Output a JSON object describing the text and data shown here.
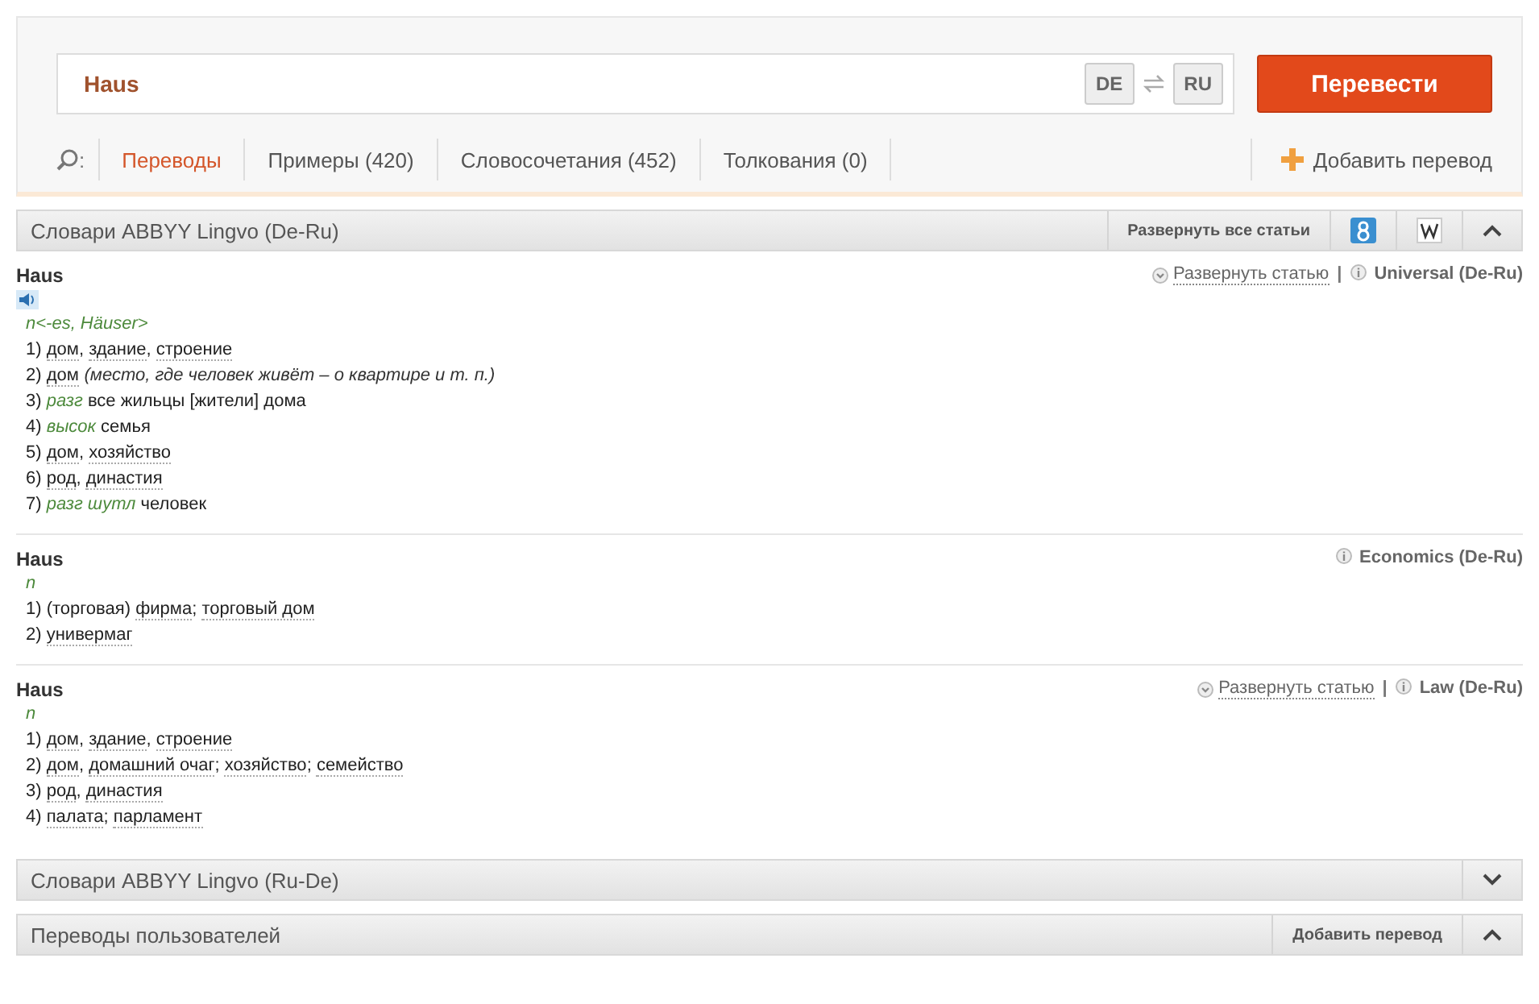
{
  "search": {
    "value": "Haus",
    "source_lang": "DE",
    "target_lang": "RU",
    "button": "Перевести"
  },
  "tabs_label": ":",
  "tabs": [
    {
      "label": "Переводы",
      "selected": true
    },
    {
      "label": "Примеры (420)",
      "selected": false
    },
    {
      "label": "Словосочетания (452)",
      "selected": false
    },
    {
      "label": "Толкования (0)",
      "selected": false
    }
  ],
  "add_translation": "Добавить перевод",
  "sections": [
    {
      "title": "Словари ABBYY Lingvo (De-Ru)",
      "expanded": true,
      "expand_all": "Развернуть все статьи",
      "tools": [
        {
          "kind": "google"
        },
        {
          "kind": "wiki"
        }
      ],
      "entries": [
        {
          "headword": "Haus",
          "sound": true,
          "expand": "Развернуть статью",
          "separator": "|",
          "dictionary": "Universal (De-Ru)",
          "grammar": "n<-es, Häuser>",
          "meanings": [
            {
              "num": "1)",
              "parts": [
                {
                  "kind": "word",
                  "text": "дом"
                },
                {
                  "kind": "text",
                  "text": ", "
                },
                {
                  "kind": "word",
                  "text": "здание"
                },
                {
                  "kind": "text",
                  "text": ", "
                },
                {
                  "kind": "word",
                  "text": "строение"
                }
              ]
            },
            {
              "num": "2)",
              "parts": [
                {
                  "kind": "word",
                  "text": "дом"
                },
                {
                  "kind": "note",
                  "text": "(место, где человек живёт – о квартире и т. п.)"
                }
              ]
            },
            {
              "num": "3)",
              "parts": [
                {
                  "kind": "label",
                  "text": "разг"
                },
                {
                  "kind": "text",
                  "text": " все жильцы [жители] дома"
                }
              ]
            },
            {
              "num": "4)",
              "parts": [
                {
                  "kind": "label",
                  "text": "высок"
                },
                {
                  "kind": "text",
                  "text": " семья"
                }
              ]
            },
            {
              "num": "5)",
              "parts": [
                {
                  "kind": "word",
                  "text": "дом"
                },
                {
                  "kind": "text",
                  "text": ", "
                },
                {
                  "kind": "word",
                  "text": "хозяйство"
                }
              ]
            },
            {
              "num": "6)",
              "parts": [
                {
                  "kind": "word",
                  "text": "род"
                },
                {
                  "kind": "text",
                  "text": ", "
                },
                {
                  "kind": "word",
                  "text": "династия"
                }
              ]
            },
            {
              "num": "7)",
              "parts": [
                {
                  "kind": "label",
                  "text": "разг шутл"
                },
                {
                  "kind": "text",
                  "text": " человек"
                }
              ]
            }
          ]
        },
        {
          "headword": "Haus",
          "dictionary": "Economics (De-Ru)",
          "grammar": "n",
          "meanings": [
            {
              "num": "1)",
              "parts": [
                {
                  "kind": "text",
                  "text": "(торговая) "
                },
                {
                  "kind": "word",
                  "text": "фирма"
                },
                {
                  "kind": "text",
                  "text": "; "
                },
                {
                  "kind": "word",
                  "text": "торговый дом"
                }
              ]
            },
            {
              "num": "2)",
              "parts": [
                {
                  "kind": "word",
                  "text": "универмаг"
                }
              ]
            }
          ]
        },
        {
          "headword": "Haus",
          "expand": "Развернуть статью",
          "separator": "|",
          "dictionary": "Law (De-Ru)",
          "grammar": "n",
          "meanings": [
            {
              "num": "1)",
              "parts": [
                {
                  "kind": "word",
                  "text": "дом"
                },
                {
                  "kind": "text",
                  "text": ", "
                },
                {
                  "kind": "word",
                  "text": "здание"
                },
                {
                  "kind": "text",
                  "text": ", "
                },
                {
                  "kind": "word",
                  "text": "строение"
                }
              ]
            },
            {
              "num": "2)",
              "parts": [
                {
                  "kind": "word",
                  "text": "дом"
                },
                {
                  "kind": "text",
                  "text": ", "
                },
                {
                  "kind": "word",
                  "text": "домашний очаг"
                },
                {
                  "kind": "text",
                  "text": "; "
                },
                {
                  "kind": "word",
                  "text": "хозяйство"
                },
                {
                  "kind": "text",
                  "text": "; "
                },
                {
                  "kind": "word",
                  "text": "семейство"
                }
              ]
            },
            {
              "num": "3)",
              "parts": [
                {
                  "kind": "word",
                  "text": "род"
                },
                {
                  "kind": "text",
                  "text": ", "
                },
                {
                  "kind": "word",
                  "text": "династия"
                }
              ]
            },
            {
              "num": "4)",
              "parts": [
                {
                  "kind": "word",
                  "text": "палата"
                },
                {
                  "kind": "text",
                  "text": "; "
                },
                {
                  "kind": "word",
                  "text": "парламент"
                }
              ]
            }
          ]
        }
      ]
    },
    {
      "title": "Словари ABBYY Lingvo (Ru-De)",
      "expanded": false
    },
    {
      "title": "Переводы пользователей",
      "expanded": true,
      "action": "Добавить перевод"
    }
  ]
}
